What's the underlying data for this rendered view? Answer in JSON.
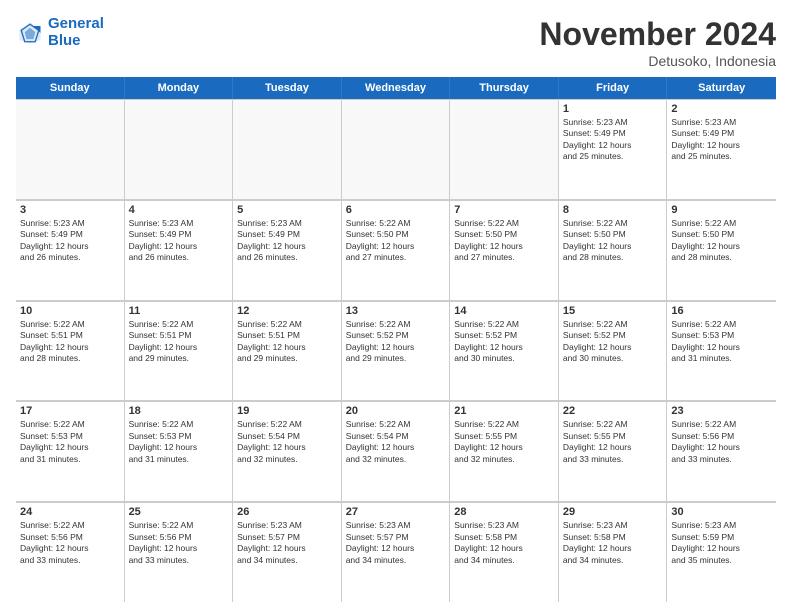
{
  "logo": {
    "line1": "General",
    "line2": "Blue"
  },
  "title": "November 2024",
  "location": "Detusoko, Indonesia",
  "weekdays": [
    "Sunday",
    "Monday",
    "Tuesday",
    "Wednesday",
    "Thursday",
    "Friday",
    "Saturday"
  ],
  "rows": [
    [
      {
        "day": "",
        "text": "",
        "empty": true
      },
      {
        "day": "",
        "text": "",
        "empty": true
      },
      {
        "day": "",
        "text": "",
        "empty": true
      },
      {
        "day": "",
        "text": "",
        "empty": true
      },
      {
        "day": "",
        "text": "",
        "empty": true
      },
      {
        "day": "1",
        "text": "Sunrise: 5:23 AM\nSunset: 5:49 PM\nDaylight: 12 hours\nand 25 minutes.",
        "empty": false
      },
      {
        "day": "2",
        "text": "Sunrise: 5:23 AM\nSunset: 5:49 PM\nDaylight: 12 hours\nand 25 minutes.",
        "empty": false
      }
    ],
    [
      {
        "day": "3",
        "text": "Sunrise: 5:23 AM\nSunset: 5:49 PM\nDaylight: 12 hours\nand 26 minutes.",
        "empty": false
      },
      {
        "day": "4",
        "text": "Sunrise: 5:23 AM\nSunset: 5:49 PM\nDaylight: 12 hours\nand 26 minutes.",
        "empty": false
      },
      {
        "day": "5",
        "text": "Sunrise: 5:23 AM\nSunset: 5:49 PM\nDaylight: 12 hours\nand 26 minutes.",
        "empty": false
      },
      {
        "day": "6",
        "text": "Sunrise: 5:22 AM\nSunset: 5:50 PM\nDaylight: 12 hours\nand 27 minutes.",
        "empty": false
      },
      {
        "day": "7",
        "text": "Sunrise: 5:22 AM\nSunset: 5:50 PM\nDaylight: 12 hours\nand 27 minutes.",
        "empty": false
      },
      {
        "day": "8",
        "text": "Sunrise: 5:22 AM\nSunset: 5:50 PM\nDaylight: 12 hours\nand 28 minutes.",
        "empty": false
      },
      {
        "day": "9",
        "text": "Sunrise: 5:22 AM\nSunset: 5:50 PM\nDaylight: 12 hours\nand 28 minutes.",
        "empty": false
      }
    ],
    [
      {
        "day": "10",
        "text": "Sunrise: 5:22 AM\nSunset: 5:51 PM\nDaylight: 12 hours\nand 28 minutes.",
        "empty": false
      },
      {
        "day": "11",
        "text": "Sunrise: 5:22 AM\nSunset: 5:51 PM\nDaylight: 12 hours\nand 29 minutes.",
        "empty": false
      },
      {
        "day": "12",
        "text": "Sunrise: 5:22 AM\nSunset: 5:51 PM\nDaylight: 12 hours\nand 29 minutes.",
        "empty": false
      },
      {
        "day": "13",
        "text": "Sunrise: 5:22 AM\nSunset: 5:52 PM\nDaylight: 12 hours\nand 29 minutes.",
        "empty": false
      },
      {
        "day": "14",
        "text": "Sunrise: 5:22 AM\nSunset: 5:52 PM\nDaylight: 12 hours\nand 30 minutes.",
        "empty": false
      },
      {
        "day": "15",
        "text": "Sunrise: 5:22 AM\nSunset: 5:52 PM\nDaylight: 12 hours\nand 30 minutes.",
        "empty": false
      },
      {
        "day": "16",
        "text": "Sunrise: 5:22 AM\nSunset: 5:53 PM\nDaylight: 12 hours\nand 31 minutes.",
        "empty": false
      }
    ],
    [
      {
        "day": "17",
        "text": "Sunrise: 5:22 AM\nSunset: 5:53 PM\nDaylight: 12 hours\nand 31 minutes.",
        "empty": false
      },
      {
        "day": "18",
        "text": "Sunrise: 5:22 AM\nSunset: 5:53 PM\nDaylight: 12 hours\nand 31 minutes.",
        "empty": false
      },
      {
        "day": "19",
        "text": "Sunrise: 5:22 AM\nSunset: 5:54 PM\nDaylight: 12 hours\nand 32 minutes.",
        "empty": false
      },
      {
        "day": "20",
        "text": "Sunrise: 5:22 AM\nSunset: 5:54 PM\nDaylight: 12 hours\nand 32 minutes.",
        "empty": false
      },
      {
        "day": "21",
        "text": "Sunrise: 5:22 AM\nSunset: 5:55 PM\nDaylight: 12 hours\nand 32 minutes.",
        "empty": false
      },
      {
        "day": "22",
        "text": "Sunrise: 5:22 AM\nSunset: 5:55 PM\nDaylight: 12 hours\nand 33 minutes.",
        "empty": false
      },
      {
        "day": "23",
        "text": "Sunrise: 5:22 AM\nSunset: 5:56 PM\nDaylight: 12 hours\nand 33 minutes.",
        "empty": false
      }
    ],
    [
      {
        "day": "24",
        "text": "Sunrise: 5:22 AM\nSunset: 5:56 PM\nDaylight: 12 hours\nand 33 minutes.",
        "empty": false
      },
      {
        "day": "25",
        "text": "Sunrise: 5:22 AM\nSunset: 5:56 PM\nDaylight: 12 hours\nand 33 minutes.",
        "empty": false
      },
      {
        "day": "26",
        "text": "Sunrise: 5:23 AM\nSunset: 5:57 PM\nDaylight: 12 hours\nand 34 minutes.",
        "empty": false
      },
      {
        "day": "27",
        "text": "Sunrise: 5:23 AM\nSunset: 5:57 PM\nDaylight: 12 hours\nand 34 minutes.",
        "empty": false
      },
      {
        "day": "28",
        "text": "Sunrise: 5:23 AM\nSunset: 5:58 PM\nDaylight: 12 hours\nand 34 minutes.",
        "empty": false
      },
      {
        "day": "29",
        "text": "Sunrise: 5:23 AM\nSunset: 5:58 PM\nDaylight: 12 hours\nand 34 minutes.",
        "empty": false
      },
      {
        "day": "30",
        "text": "Sunrise: 5:23 AM\nSunset: 5:59 PM\nDaylight: 12 hours\nand 35 minutes.",
        "empty": false
      }
    ]
  ]
}
